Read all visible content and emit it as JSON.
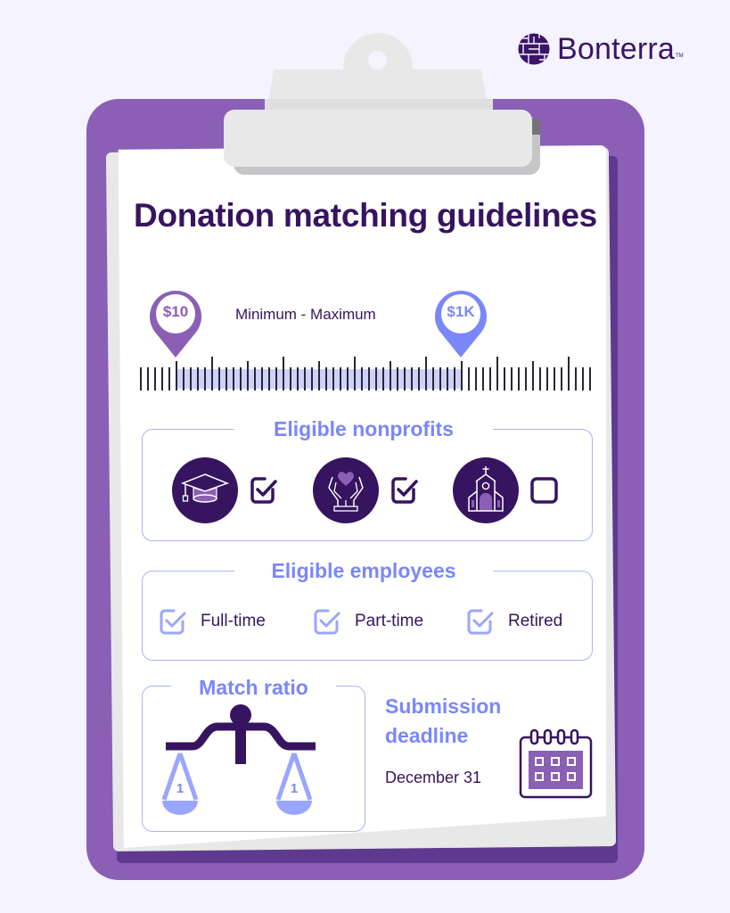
{
  "brand": {
    "name": "Bonterra",
    "trademark": "TM",
    "logo_icon": "woven-globe-icon",
    "color": "#3b1465"
  },
  "colors": {
    "background": "#f4f3fe",
    "clipboard": "#8a5fb5",
    "dark_purple": "#36145f",
    "accent_blue": "#7a87fb",
    "light_blue": "#9aa6fd",
    "mid_purple": "#8a5fb5"
  },
  "title": "Donation matching guidelines",
  "range": {
    "min_label": "$10",
    "max_label": "$1K",
    "caption": "Minimum - Maximum",
    "min_color": "#8a5fb5",
    "max_color": "#7a87fb"
  },
  "eligible_nonprofits": {
    "heading": "Eligible nonprofits",
    "items": [
      {
        "name": "Education",
        "icon": "graduation-cap-icon",
        "checked": true
      },
      {
        "name": "Charity / human services",
        "icon": "hands-heart-icon",
        "checked": true
      },
      {
        "name": "Religious organizations",
        "icon": "church-icon",
        "checked": false
      }
    ]
  },
  "eligible_employees": {
    "heading": "Eligible employees",
    "items": [
      {
        "label": "Full-time",
        "checked": true
      },
      {
        "label": "Part-time",
        "checked": true
      },
      {
        "label": "Retired",
        "checked": true
      }
    ]
  },
  "match_ratio": {
    "heading": "Match ratio",
    "left": "1",
    "right": "1",
    "icon": "balance-scale-icon"
  },
  "submission_deadline": {
    "heading_line1": "Submission",
    "heading_line2": "deadline",
    "date": "December 31",
    "icon": "calendar-icon"
  }
}
